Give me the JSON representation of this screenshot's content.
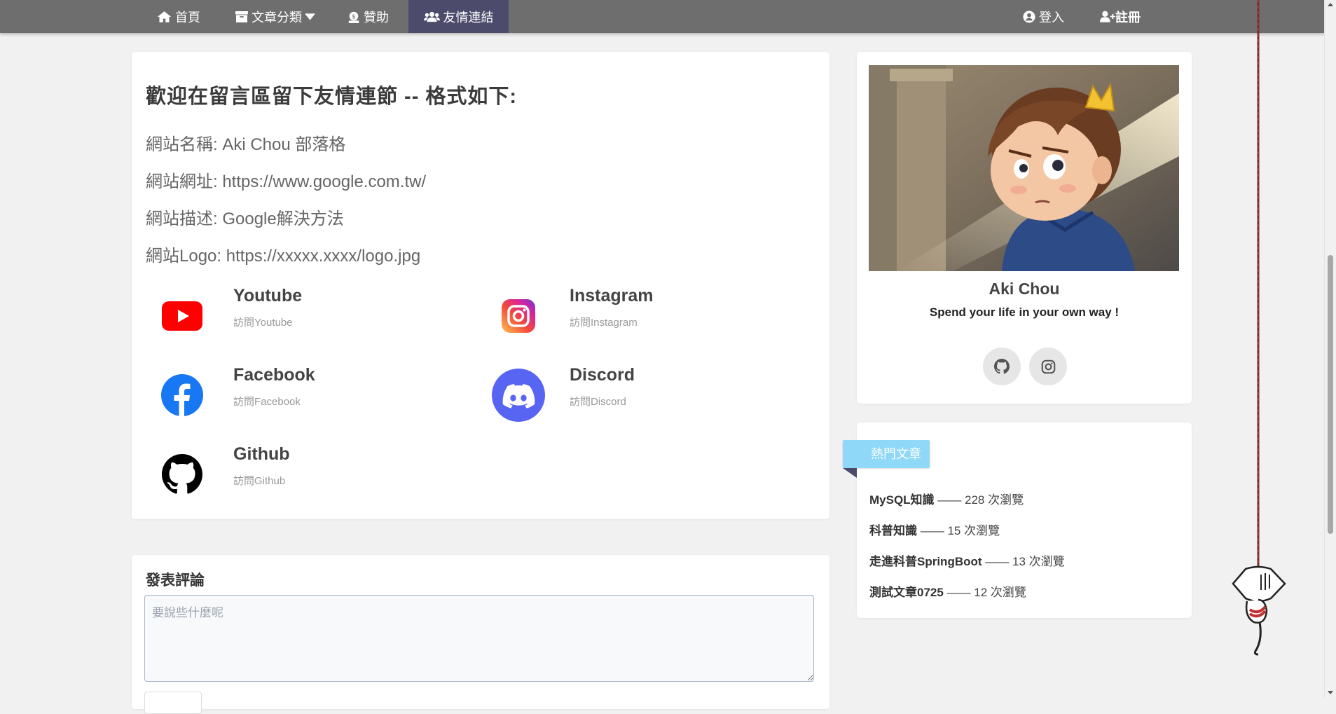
{
  "nav": {
    "home": "首頁",
    "category": "文章分類",
    "sponsor": "贊助",
    "friend_links": "友情連結",
    "login": "登入",
    "register": "註冊"
  },
  "intro": {
    "title": "歡迎在留言區留下友情連節 -- 格式如下:",
    "lines": [
      "網站名稱: Aki Chou 部落格",
      "網站網址: https://www.google.com.tw/",
      "網站描述: Google解決方法",
      "網站Logo: https://xxxxx.xxxx/logo.jpg"
    ]
  },
  "links": [
    {
      "name": "Youtube",
      "desc": "訪問Youtube",
      "icon": "youtube-icon",
      "color": "#ff0000"
    },
    {
      "name": "Instagram",
      "desc": "訪問Instagram",
      "icon": "instagram-icon",
      "color": "#d6249f"
    },
    {
      "name": "Facebook",
      "desc": "訪問Facebook",
      "icon": "facebook-icon",
      "color": "#1877f2"
    },
    {
      "name": "Discord",
      "desc": "訪問Discord",
      "icon": "discord-icon",
      "color": "#5865f2"
    },
    {
      "name": "Github",
      "desc": "訪問Github",
      "icon": "github-icon",
      "color": "#000000"
    }
  ],
  "comment": {
    "title": "發表評論",
    "placeholder": "要說些什麼呢"
  },
  "profile": {
    "name": "Aki Chou",
    "motto": "Spend your life in your own way !"
  },
  "hot": {
    "tag": "熱門文章",
    "items": [
      {
        "title": "MySQL知識",
        "views": "—— 228 次瀏覽"
      },
      {
        "title": "科普知識",
        "views": "—— 15 次瀏覽"
      },
      {
        "title": "走進科普SpringBoot",
        "views": "—— 13 次瀏覽"
      },
      {
        "title": "測試文章0725",
        "views": "—— 12 次瀏覽"
      }
    ]
  },
  "colors": {
    "navbar": "#6e6e6e",
    "nav_active": "#4c4b6c",
    "hot_tag": "#8fd8f7"
  }
}
